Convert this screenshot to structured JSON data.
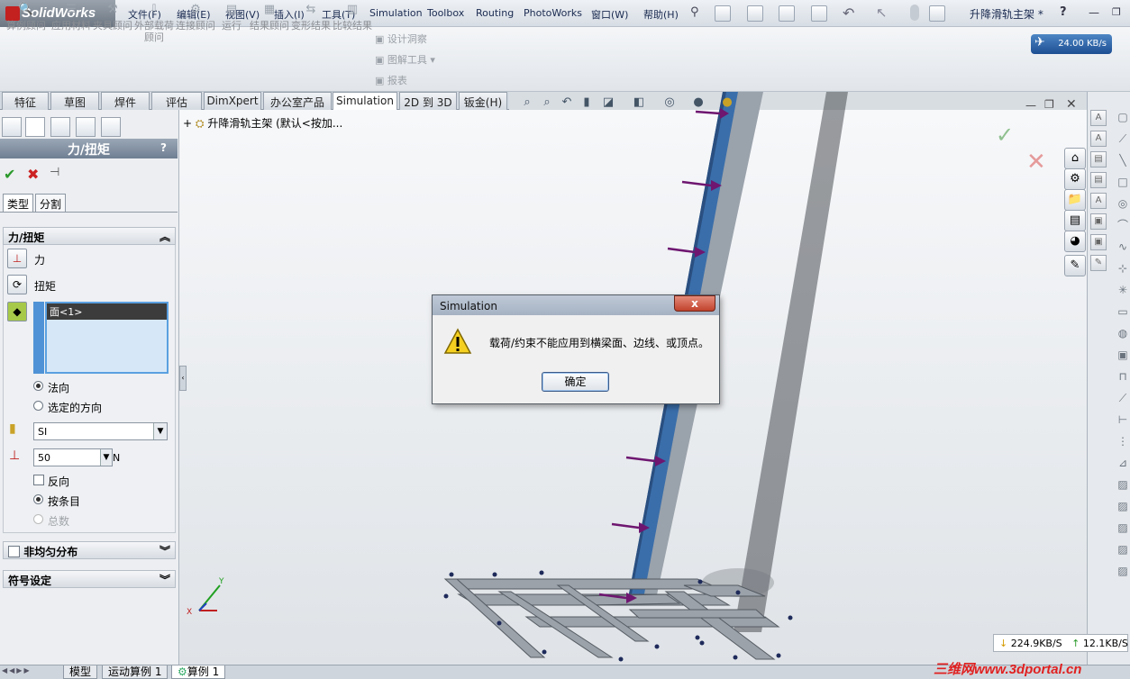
{
  "app": {
    "logo_text": "SolidWorks",
    "document_title": "升降滑轨主架 *"
  },
  "menu": [
    "文件(F)",
    "编辑(E)",
    "视图(V)",
    "插入(I)",
    "工具(T)",
    "Simulation",
    "Toolbox",
    "Routing",
    "PhotoWorks",
    "窗口(W)",
    "帮助(H)"
  ],
  "commands": [
    {
      "label": "算例顾问",
      "icon": "study-advisor-icon"
    },
    {
      "label": "应用材料",
      "icon": "apply-material-icon"
    },
    {
      "label": "夹具顾问",
      "icon": "fixtures-advisor-icon"
    },
    {
      "label": "外部载荷顾问",
      "icon": "external-loads-icon"
    },
    {
      "label": "连接顾问",
      "icon": "connections-advisor-icon"
    },
    {
      "label": "运行",
      "icon": "run-icon"
    },
    {
      "label": "结果顾问",
      "icon": "results-advisor-icon"
    },
    {
      "label": "变形结果",
      "icon": "deformed-result-icon"
    },
    {
      "label": "比较结果",
      "icon": "compare-results-icon"
    }
  ],
  "command_extras": [
    "设计洞察",
    "图解工具",
    "报表"
  ],
  "speed_badge": "24.00 KB/s",
  "tabs": [
    "特征",
    "草图",
    "焊件",
    "评估",
    "DimXpert",
    "办公室产品",
    "Simulation",
    "2D 到 3D",
    "钣金(H)"
  ],
  "active_tab": "Simulation",
  "tree_root": "升降滑轨主架 (默认<按加...",
  "property_manager": {
    "title": "力/扭矩",
    "help": "?",
    "sub_tabs": [
      "类型",
      "分割"
    ],
    "group_title": "力/扭矩",
    "force_label": "力",
    "torque_label": "扭矩",
    "selection_item": "面<1>",
    "direction_normal": "法向",
    "direction_selected": "选定的方向",
    "unit_system": "SI",
    "force_value": "50",
    "force_unit": "N",
    "reverse_label": "反向",
    "per_item_label": "按条目",
    "total_label": "总数",
    "nonuniform_label": "非均匀分布",
    "symbol_settings_label": "符号设定"
  },
  "dialog": {
    "title": "Simulation",
    "message": "载荷/约束不能应用到横梁面、边线、或顶点。",
    "ok_label": "确定",
    "close_label": "x"
  },
  "bottom_tabs": [
    "模型",
    "运动算例 1",
    "算例 1"
  ],
  "active_bottom_tab": "算例 1",
  "network": {
    "down": "224.9KB/S",
    "up": "12.1KB/S"
  },
  "watermark": "三维网www.3dportal.cn",
  "colors": {
    "beam": "#3a6eaa",
    "force_arrow": "#6e1670",
    "frame": "#9aa1a9",
    "dialog_title": "#a5b2c3",
    "ok_green": "#3aa53a",
    "cancel_red": "#cc2222"
  }
}
